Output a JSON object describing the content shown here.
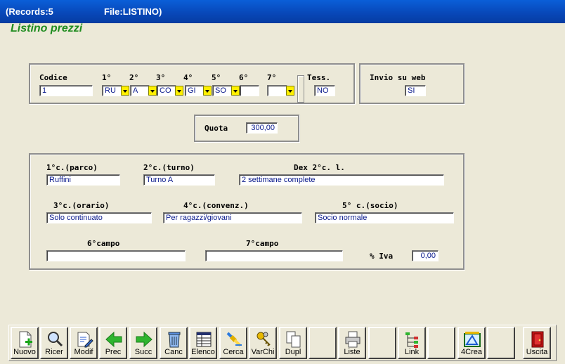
{
  "titlebar": {
    "records": "(Records:5",
    "file": "File:LISTINO)"
  },
  "form": {
    "title": "Listino prezzi"
  },
  "codes_group": {
    "codice_label": "Codice",
    "codice_value": "1",
    "slots": [
      {
        "label": "1°",
        "value": "RU"
      },
      {
        "label": "2°",
        "value": "A"
      },
      {
        "label": "3°",
        "value": "CO"
      },
      {
        "label": "4°",
        "value": "GI"
      },
      {
        "label": "5°",
        "value": "SO"
      },
      {
        "label": "6°",
        "value": ""
      },
      {
        "label": "7°",
        "value": ""
      }
    ],
    "tess_label": "Tess.",
    "tess_value": "NO"
  },
  "web_group": {
    "label": "Invio su web",
    "value": "SI"
  },
  "quota_group": {
    "label": "Quota",
    "value": "300,00"
  },
  "details": {
    "parco": {
      "label": "1°c.(parco)",
      "value": "Ruffini"
    },
    "turno": {
      "label": "2°c.(turno)",
      "value": "Turno A"
    },
    "dex": {
      "label": "Dex 2°c. l.",
      "value": "2 settimane complete"
    },
    "orario": {
      "label": "3°c.(orario)",
      "value": "Solo continuato"
    },
    "convenz": {
      "label": "4°c.(convenz.)",
      "value": "Per ragazzi/giovani"
    },
    "socio": {
      "label": "5° c.(socio)",
      "value": "Socio normale"
    },
    "campo6": {
      "label": "6°campo",
      "value": ""
    },
    "campo7": {
      "label": "7°campo",
      "value": ""
    },
    "iva": {
      "label": "% Iva",
      "value": "0,00"
    }
  },
  "toolbar": {
    "nuovo": "Nuovo",
    "ricer": "Ricer",
    "modif": "Modif",
    "prec": "Prec",
    "succ": "Succ",
    "canc": "Canc",
    "elenco": "Elenco",
    "cerca": "Cerca",
    "varchi": "VarChi",
    "dupl": "Dupl",
    "liste": "Liste",
    "link": "Link",
    "crea": "4Crea",
    "uscita": "Uscita"
  }
}
